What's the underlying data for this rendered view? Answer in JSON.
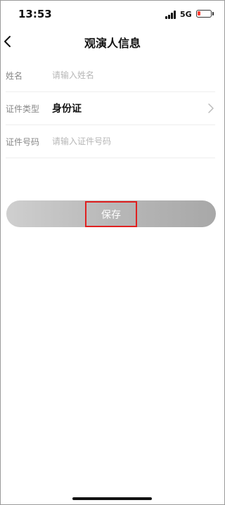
{
  "status_bar": {
    "time": "13:53",
    "network": "5G",
    "battery_color": "#ff3b30"
  },
  "nav": {
    "title": "观演人信息",
    "back_icon": "chevron-left-icon"
  },
  "form": {
    "name": {
      "label": "姓名",
      "placeholder": "请输入姓名",
      "value": ""
    },
    "id_type": {
      "label": "证件类型",
      "value": "身份证",
      "icon": "chevron-right-icon"
    },
    "id_number": {
      "label": "证件号码",
      "placeholder": "请输入证件号码",
      "value": ""
    }
  },
  "save_button": {
    "label": "保存",
    "highlight_color": "#e02020"
  }
}
